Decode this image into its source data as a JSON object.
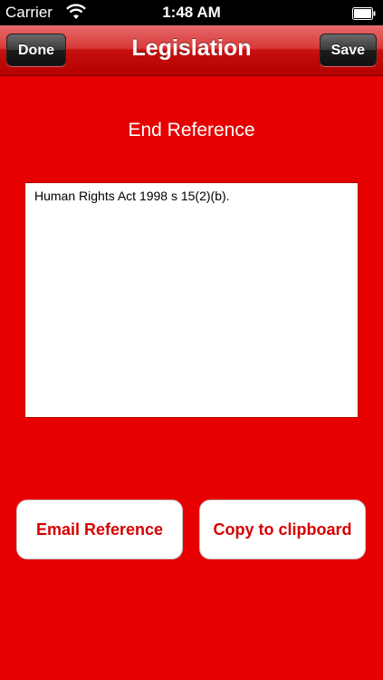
{
  "status_bar": {
    "carrier": "Carrier",
    "time": "1:48 AM",
    "wifi_icon": "wifi-icon",
    "battery_icon": "battery-icon"
  },
  "nav": {
    "title": "Legislation",
    "left_button": "Done",
    "right_button": "Save"
  },
  "content": {
    "heading": "End Reference",
    "reference_text": "Human Rights Act 1998 s 15(2)(b)."
  },
  "actions": {
    "email_label": "Email Reference",
    "copy_label": "Copy to clipboard"
  },
  "colors": {
    "background": "#e60000",
    "accent_text": "#d60000"
  }
}
